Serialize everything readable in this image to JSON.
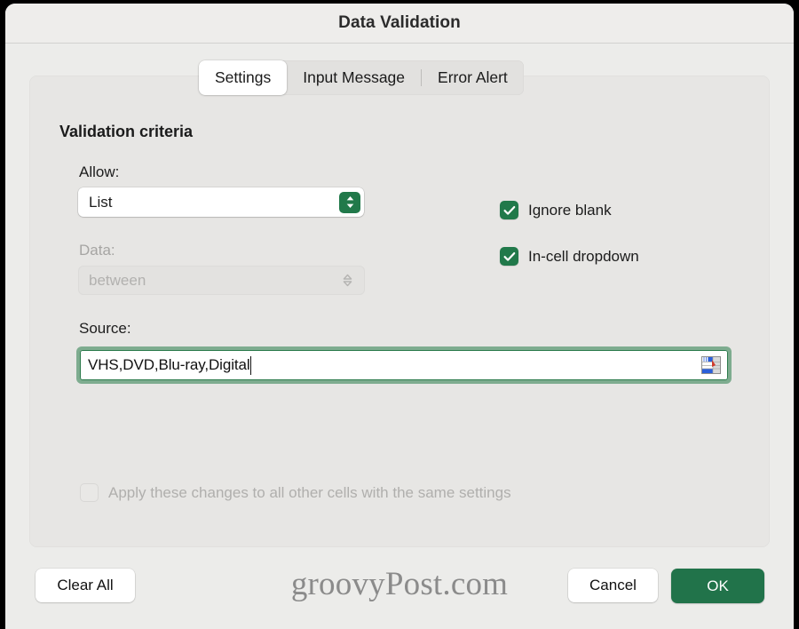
{
  "window": {
    "title": "Data Validation"
  },
  "tabs": [
    {
      "label": "Settings",
      "active": true
    },
    {
      "label": "Input Message",
      "active": false
    },
    {
      "label": "Error Alert",
      "active": false
    }
  ],
  "panel": {
    "section_title": "Validation criteria",
    "allow": {
      "label": "Allow:",
      "value": "List",
      "enabled": true,
      "icon": "chevron-up-down-icon"
    },
    "data": {
      "label": "Data:",
      "value": "between",
      "enabled": false,
      "icon": "chevron-up-down-icon"
    },
    "source": {
      "label": "Source:",
      "value": "VHS,DVD,Blu-ray,Digital",
      "placeholder": "",
      "focused": true,
      "picker_icon": "range-selector-icon"
    },
    "options": [
      {
        "label": "Ignore blank",
        "checked": true,
        "enabled": true
      },
      {
        "label": "In-cell dropdown",
        "checked": true,
        "enabled": true
      }
    ],
    "apply_all": {
      "label": "Apply these changes to all other cells with the same settings",
      "checked": false,
      "enabled": false
    }
  },
  "footer": {
    "clear_all": "Clear All",
    "cancel": "Cancel",
    "ok": "OK",
    "watermark": "groovyPost.com"
  },
  "colors": {
    "accent_green": "#21794a",
    "primary_button_green": "#21734a",
    "focus_ring_green": "#7eac8f",
    "window_bg": "#ececea",
    "panel_bg": "#e7e6e4",
    "titlebar_bg": "#eeedeb"
  }
}
